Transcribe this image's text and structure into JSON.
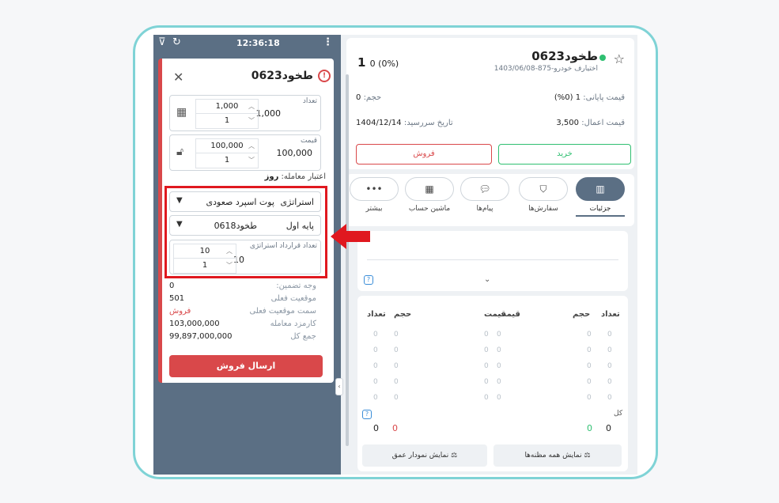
{
  "status_bar": {
    "time": "12:36:18"
  },
  "order_panel": {
    "title": "طخود0623",
    "quantity": {
      "label": "تعداد",
      "value": "1,000",
      "step_top": "1,000",
      "step_bottom": "1"
    },
    "price": {
      "label": "قیمت",
      "value": "100,000",
      "step_top": "100,000",
      "step_bottom": "1"
    },
    "validity": {
      "label": "اعتبار معامله:",
      "value": "روز"
    },
    "strategy": {
      "label": "استراتژی",
      "value": "پوت اسپرد صعودی"
    },
    "base": {
      "label": "پایه اول",
      "value": "طخود0618"
    },
    "strategy_count": {
      "label": "تعداد قرارداد استراتژی",
      "value": "10",
      "step_top": "10",
      "step_bottom": "1"
    },
    "summary": [
      {
        "label": "وجه تضمین:",
        "value": "0"
      },
      {
        "label": "موقعیت فعلی",
        "value": "501"
      },
      {
        "label": "سمت موقعیت فعلی",
        "value": "فروش",
        "color": "#d9484a"
      },
      {
        "label": "کارمزد معامله",
        "value": "103,000,000"
      },
      {
        "label": "جمع کل",
        "value": "99,897,000,000"
      }
    ],
    "submit_label": "ارسال فروش"
  },
  "symbol": {
    "name": "طخود0623",
    "subtitle": "اختیارف خودرو-875-1403/06/08",
    "price": "1",
    "change": "0 (0%)",
    "volume_label": "حجم:",
    "volume": "0",
    "final_price_label": "قیمت پایانی:",
    "final_price": "1  (0%)",
    "expiry_label": "تاریخ سررسید:",
    "expiry": "1404/12/14",
    "strike_label": "قیمت اعمال:",
    "strike": "3,500",
    "sell_label": "فروش",
    "buy_label": "خرید"
  },
  "tabs": [
    {
      "label": "جزئیات",
      "icon": "chart-icon",
      "active": true
    },
    {
      "label": "سفارش‌ها",
      "icon": "basket-icon"
    },
    {
      "label": "پیام‌ها",
      "icon": "chat-icon"
    },
    {
      "label": "ماشین حساب",
      "icon": "calculator-icon"
    },
    {
      "label": "بیشتر",
      "icon": "more-icon"
    }
  ],
  "orderbook": {
    "headers_buy": [
      "تعداد",
      "حجم",
      "قیمت"
    ],
    "headers_sell": [
      "قیمت",
      "حجم",
      "تعداد"
    ],
    "total_label": "کل",
    "total_buy": [
      "0",
      "0"
    ],
    "total_sell": [
      "0",
      "0"
    ],
    "row_value": "0"
  },
  "bottom_buttons": {
    "all_suspects": "نمایش همه مظنه‌ها",
    "depth_chart": "نمایش نمودار عمق"
  },
  "colors": {
    "accent": "#5b6f84",
    "sell": "#d9484a",
    "buy": "#2fbf71",
    "highlight": "#e0181f",
    "frame": "#7fd3d6"
  }
}
